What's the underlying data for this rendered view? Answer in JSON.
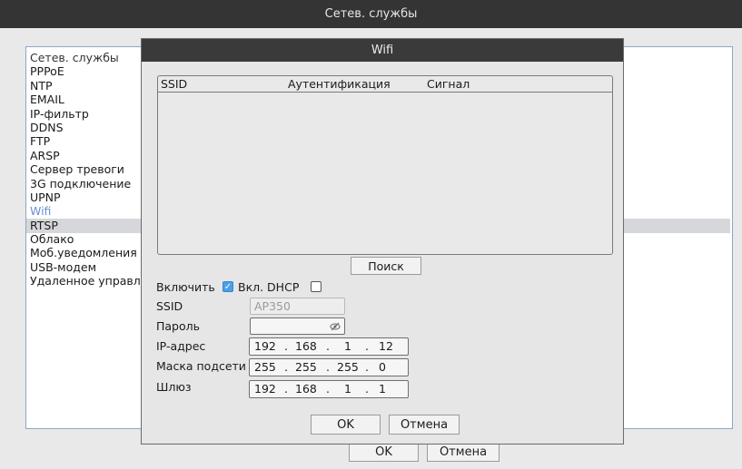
{
  "window": {
    "title": "Сетев. службы"
  },
  "services": {
    "header": "Сетев. службы",
    "items": [
      "PPPoE",
      "NTP",
      "EMAIL",
      "IP-фильтр",
      "DDNS",
      "FTP",
      "ARSP",
      "Сервер тревоги",
      "3G подключение",
      "UPNP",
      "Wifi",
      "RTSP",
      "Облако",
      "Моб.уведомления",
      "USB-модем",
      "Удаленное управле"
    ],
    "selected": "Wifi"
  },
  "outer_buttons": {
    "ok": "OK",
    "cancel": "Отмена"
  },
  "dialog": {
    "title": "Wifi",
    "table": {
      "columns": [
        "SSID",
        "Аутентификация",
        "Сигнал"
      ],
      "rows": []
    },
    "search_button": "Поиск",
    "enable": {
      "label": "Включить",
      "checked": true
    },
    "dhcp": {
      "label": "Вкл. DHCP",
      "checked": false
    },
    "ssid": {
      "label": "SSID",
      "value": "AP350"
    },
    "password": {
      "label": "Пароль",
      "value": "",
      "icon": "eye-icon"
    },
    "ip": {
      "label": "IP-адрес",
      "octets": [
        "192",
        "168",
        "1",
        "12"
      ]
    },
    "mask": {
      "label": "Маска подсети",
      "octets": [
        "255",
        "255",
        "255",
        "0"
      ]
    },
    "gateway": {
      "label": "Шлюз",
      "octets": [
        "192",
        "168",
        "1",
        "1"
      ]
    },
    "ok": "OK",
    "cancel": "Отмена"
  },
  "colors": {
    "selected_text": "#6a8fd4",
    "checkbox_on": "#4a9fe8",
    "titlebar": "#343434"
  }
}
